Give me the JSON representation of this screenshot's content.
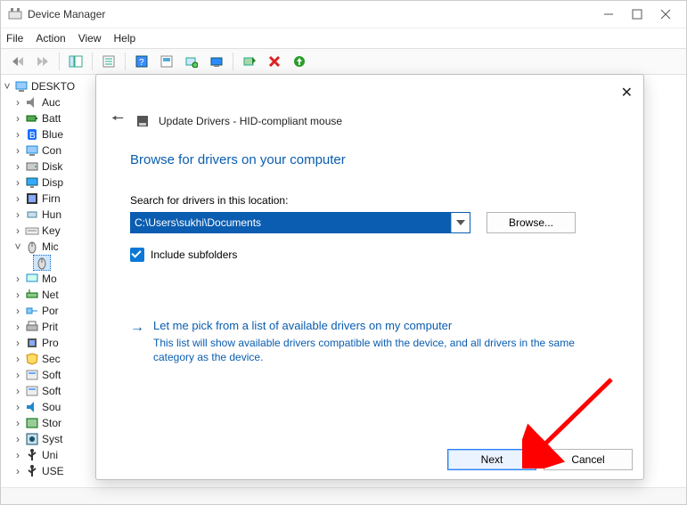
{
  "titlebar": {
    "title": "Device Manager"
  },
  "menubar": {
    "file": "File",
    "action": "Action",
    "view": "View",
    "help": "Help"
  },
  "tree": {
    "root": "DESKTO",
    "items": [
      {
        "label": "Auc",
        "icon": "audio"
      },
      {
        "label": "Batt",
        "icon": "battery"
      },
      {
        "label": "Blue",
        "icon": "bluetooth"
      },
      {
        "label": "Con",
        "icon": "computer"
      },
      {
        "label": "Disk",
        "icon": "disk"
      },
      {
        "label": "Disp",
        "icon": "display"
      },
      {
        "label": "Firn",
        "icon": "firmware"
      },
      {
        "label": "Hun",
        "icon": "hid"
      },
      {
        "label": "Key",
        "icon": "keyboard"
      },
      {
        "label": "Mic",
        "icon": "mouse",
        "expanded": true,
        "children": [
          {
            "label": "",
            "icon": "mouse",
            "hl": true
          }
        ]
      },
      {
        "label": "Mo",
        "icon": "monitor"
      },
      {
        "label": "Net",
        "icon": "network"
      },
      {
        "label": "Por",
        "icon": "port"
      },
      {
        "label": "Prit",
        "icon": "printqueue"
      },
      {
        "label": "Pro",
        "icon": "processor"
      },
      {
        "label": "Sec",
        "icon": "security"
      },
      {
        "label": "Soft",
        "icon": "software"
      },
      {
        "label": "Soft",
        "icon": "software"
      },
      {
        "label": "Sou",
        "icon": "sound"
      },
      {
        "label": "Stor",
        "icon": "storage"
      },
      {
        "label": "Syst",
        "icon": "system"
      },
      {
        "label": "Uni",
        "icon": "usb"
      },
      {
        "label": "USE",
        "icon": "usb"
      }
    ]
  },
  "dialog": {
    "title": "Update Drivers - HID-compliant mouse",
    "heading": "Browse for drivers on your computer",
    "search_label": "Search for drivers in this location:",
    "location_value": "C:\\Users\\sukhi\\Documents",
    "browse": "Browse...",
    "include_subfolders": "Include subfolders",
    "pick_title": "Let me pick from a list of available drivers on my computer",
    "pick_desc": "This list will show available drivers compatible with the device, and all drivers in the same category as the device.",
    "next": "Next",
    "cancel": "Cancel"
  }
}
